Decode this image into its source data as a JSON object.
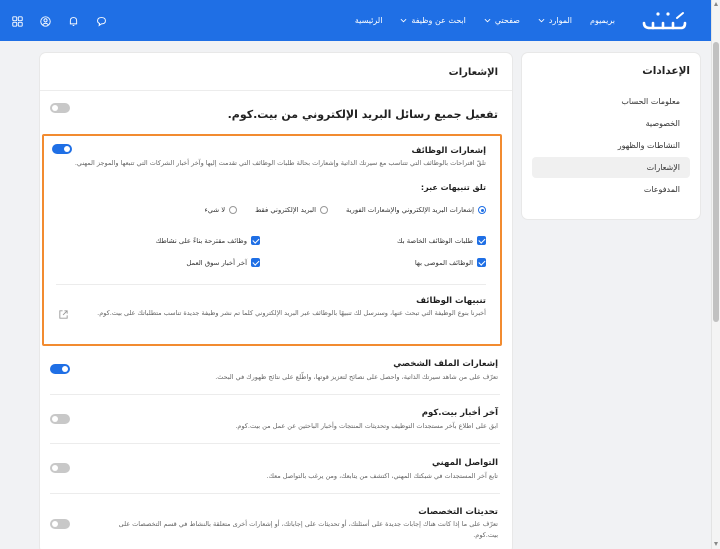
{
  "topbar": {
    "logo_text": "بيت",
    "nav": [
      {
        "label": "الرئيسية",
        "has_menu": false
      },
      {
        "label": "ابحث عن وظيفة",
        "has_menu": true
      },
      {
        "label": "صفحتي",
        "has_menu": true
      },
      {
        "label": "الموارد",
        "has_menu": true
      },
      {
        "label": "بريميوم",
        "has_menu": false
      }
    ],
    "icons": [
      "grid-icon",
      "user-circle-icon",
      "bell-icon",
      "chat-icon"
    ]
  },
  "sidebar": {
    "title": "الإعدادات",
    "items": [
      {
        "label": "معلومات الحساب",
        "active": false
      },
      {
        "label": "الخصوصية",
        "active": false
      },
      {
        "label": "النشاطات والظهور",
        "active": false
      },
      {
        "label": "الإشعارات",
        "active": true
      },
      {
        "label": "المدفوعات",
        "active": false
      }
    ]
  },
  "main": {
    "title": "الإشعارات",
    "master": {
      "label": "تفعيل جميع رسائل البريد الإلكتروني من بيت.كوم.",
      "on": false
    },
    "job_notifications": {
      "title": "إشعارات الوظائف",
      "desc": "تلقّ اقتراحات بالوظائف التي تتناسب مع سيرتك الذاتية وإشعارات بحالة طلبات الوظائف التي تقدمت إليها وآخر أخبار الشركات التي تتبعها والموجز المهني.",
      "on": true,
      "receive_title": "تلق تنبيهات عبر:",
      "radios": [
        {
          "label": "إشعارات البريد الإلكتروني والإشعارات الفورية",
          "selected": true
        },
        {
          "label": "البريد الإلكتروني فقط",
          "selected": false
        },
        {
          "label": "لا شيء",
          "selected": false
        }
      ],
      "checks": [
        {
          "label": "طلبات الوظائف الخاصة بك",
          "checked": true
        },
        {
          "label": "وظائف مقترحة بناءً على نشاطك",
          "checked": true
        },
        {
          "label": "الوظائف الموصى بها",
          "checked": true
        },
        {
          "label": "آخر أخبار سوق العمل",
          "checked": true
        }
      ],
      "alerts_title": "تنبيهات الوظائف",
      "alerts_desc": "أخبرنا بنوع الوظيفة التي تبحث عنها، وسنرسل لك تنبيهًا بالوظائف عبر البريد الإلكتروني كلما تم نشر وظيفة جديدة تناسب متطلباتك على بيت.كوم."
    },
    "sections": [
      {
        "title": "إشعارات الملف الشخصي",
        "desc": "تعرّف على من شاهد سيرتك الذاتية، واحصل على نصائح لتعزيز قوتها، واطّلع على نتائج ظهورك في البحث.",
        "on": true
      },
      {
        "title": "آخر أخبار بيت.كوم",
        "desc": "ابق على اطلاع بآخر مستجدات التوظيف وتحديثات المنتجات وأخبار الباحثين عن عمل من بيت.كوم.",
        "on": false
      },
      {
        "title": "التواصل المهني",
        "desc": "تابع آخر المستجدات في شبكتك المهني، اكتشف من يتابعك، ومن يرغب بالتواصل معك.",
        "on": false
      },
      {
        "title": "تحديثات التخصصات",
        "desc": "تعرّف على ما إذا كانت هناك إجابات جديدة على أسئلتك، أو تحديثات على إجاباتك، أو إشعارات أخرى متعلقة بالنشاط في قسم التخصصات على بيت.كوم.",
        "on": false
      }
    ]
  },
  "colors": {
    "brand": "#1f6fe5",
    "highlight": "#f28b30"
  }
}
